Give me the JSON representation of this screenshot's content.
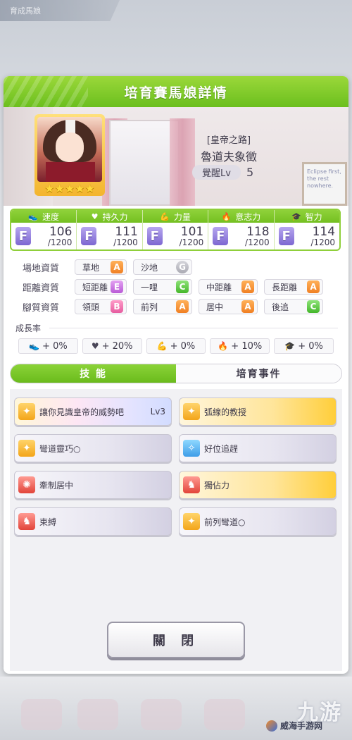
{
  "background": {
    "top_tab_label": "育成馬娘"
  },
  "header": {
    "title": "培育賽馬娘詳情"
  },
  "character": {
    "epithet": "[皇帝之路]",
    "name": "魯道夫象徵",
    "awakening_label": "覺醒Lv",
    "awakening_level": "5",
    "stars": "★★★★★",
    "board_text": "Eclipse first, the rest nowhere."
  },
  "stats": [
    {
      "label": "速度",
      "icon": "shoe-icon",
      "grade": "F",
      "value": "106",
      "max": "/1200"
    },
    {
      "label": "持久力",
      "icon": "heart-icon",
      "grade": "F",
      "value": "111",
      "max": "/1200"
    },
    {
      "label": "力量",
      "icon": "muscle-icon",
      "grade": "F",
      "value": "101",
      "max": "/1200"
    },
    {
      "label": "意志力",
      "icon": "flame-icon",
      "grade": "F",
      "value": "118",
      "max": "/1200"
    },
    {
      "label": "智力",
      "icon": "graduation-cap-icon",
      "grade": "F",
      "value": "114",
      "max": "/1200"
    }
  ],
  "aptitude": {
    "track": {
      "label": "場地資質",
      "items": [
        {
          "name": "草地",
          "grade": "A"
        },
        {
          "name": "沙地",
          "grade": "G"
        }
      ]
    },
    "distance": {
      "label": "距離資質",
      "items": [
        {
          "name": "短距離",
          "grade": "E"
        },
        {
          "name": "一哩",
          "grade": "C"
        },
        {
          "name": "中距離",
          "grade": "A"
        },
        {
          "name": "長距離",
          "grade": "A"
        }
      ]
    },
    "style": {
      "label": "腳質資質",
      "items": [
        {
          "name": "領頭",
          "grade": "B"
        },
        {
          "name": "前列",
          "grade": "A"
        },
        {
          "name": "居中",
          "grade": "A"
        },
        {
          "name": "後追",
          "grade": "C"
        }
      ]
    }
  },
  "growth": {
    "title": "成長率",
    "items": [
      "+ 0%",
      "+ 20%",
      "+ 0%",
      "+ 10%",
      "+ 0%"
    ]
  },
  "tabs": {
    "skills": "技 能",
    "events": "培育事件"
  },
  "skills": [
    {
      "name": "讓你見識皇帝的威勢吧",
      "level": "Lv3"
    },
    {
      "name": "弧線的教授",
      "level": ""
    },
    {
      "name": "彎道靈巧○",
      "level": ""
    },
    {
      "name": "好位追趕",
      "level": ""
    },
    {
      "name": "牽制居中",
      "level": ""
    },
    {
      "name": "獨佔力",
      "level": ""
    },
    {
      "name": "束縛",
      "level": ""
    },
    {
      "name": "前列彎道○",
      "level": ""
    }
  ],
  "close_button": "關 閉",
  "watermark": {
    "big": "九游",
    "text": "威海手游网"
  },
  "colors": {
    "accent_green": "#7cc52a",
    "grade_F": "#8c76dc",
    "grade_A": "#f28a2c",
    "grade_B": "#ea6aa8",
    "grade_C": "#4cbb33",
    "grade_E": "#c06ade",
    "grade_G": "#b0b0b8"
  }
}
